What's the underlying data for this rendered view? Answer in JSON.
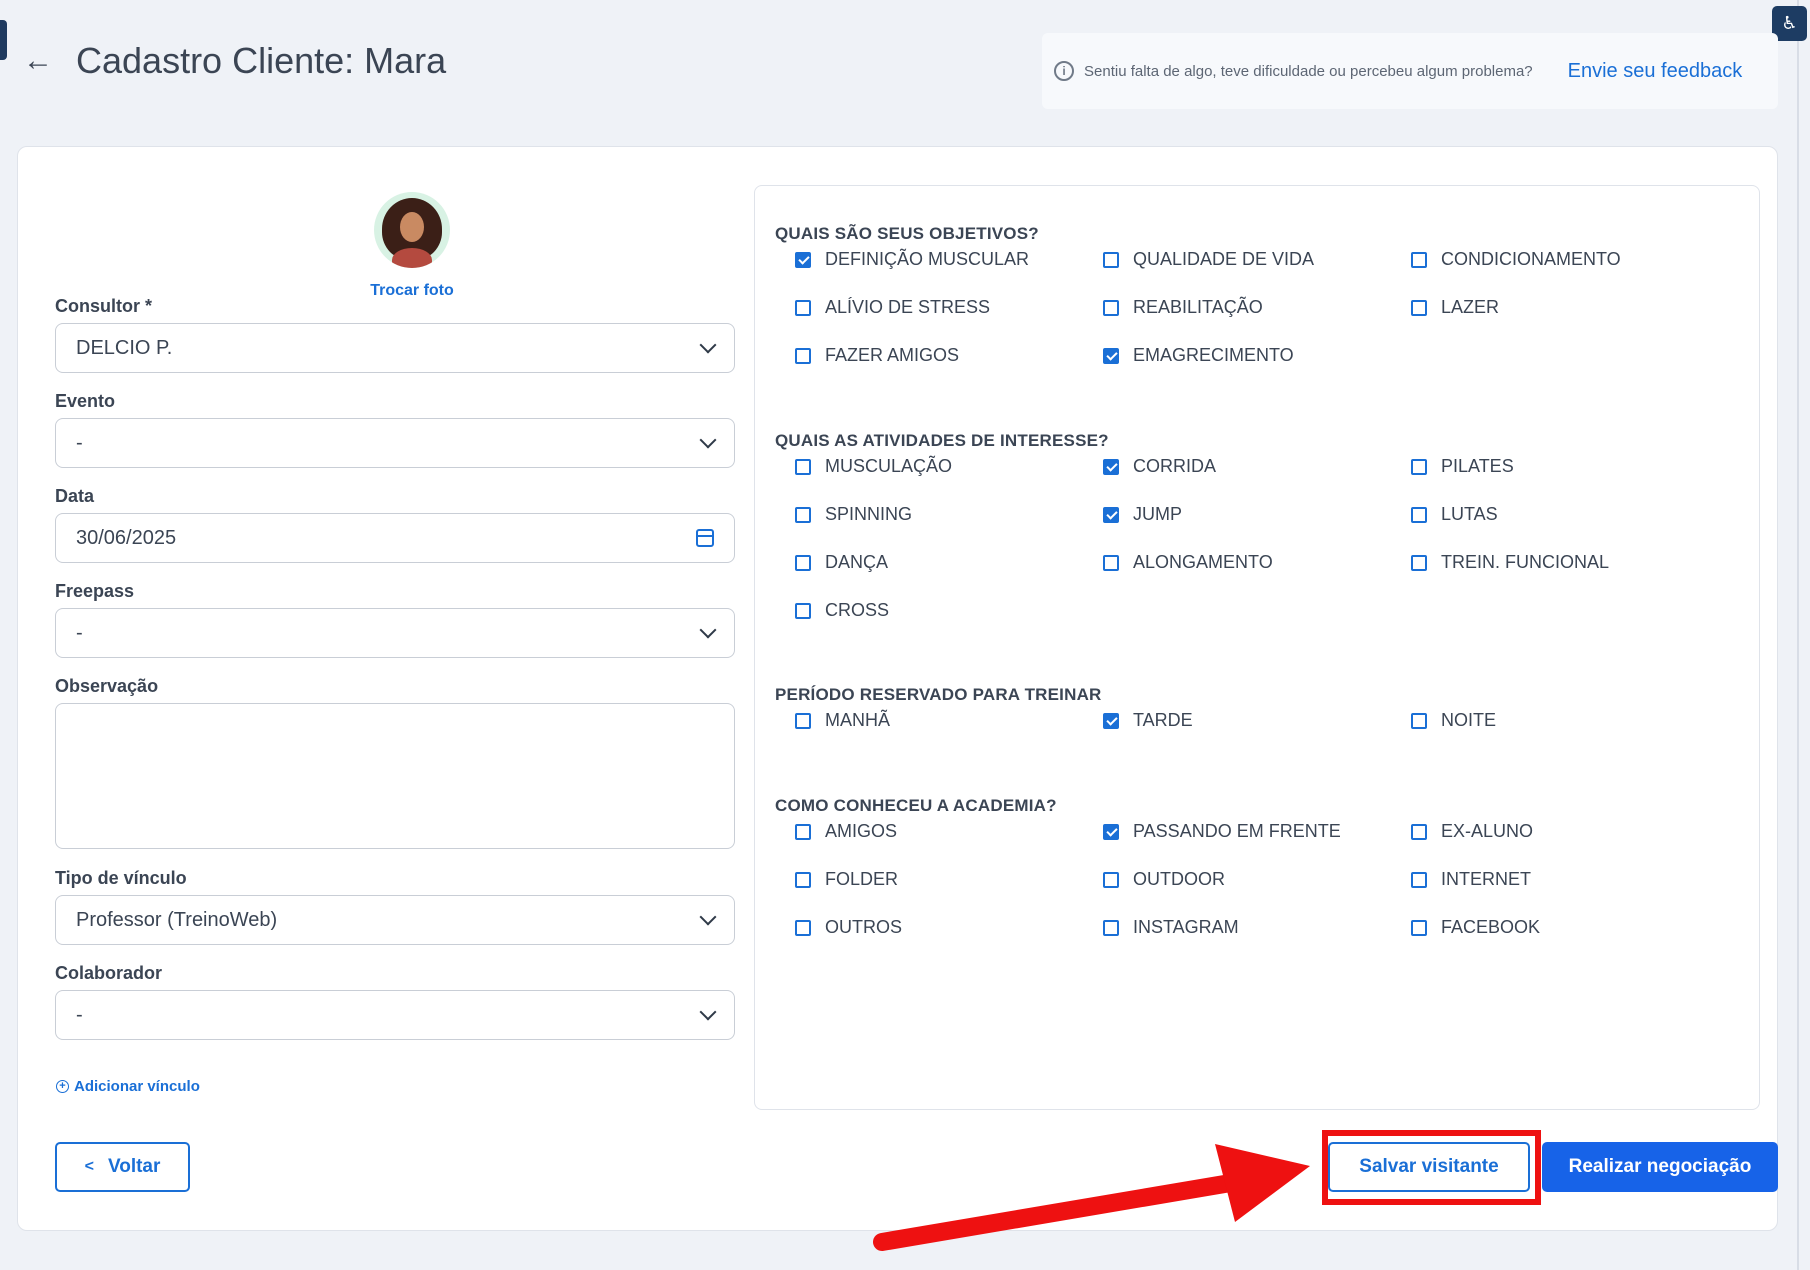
{
  "header": {
    "title": "Cadastro Cliente: Mara",
    "feedback_text": "Sentiu falta de algo, teve dificuldade ou percebeu algum problema?",
    "feedback_link": "Envie seu feedback"
  },
  "profile": {
    "change_photo": "Trocar foto"
  },
  "form": {
    "consultor": {
      "label": "Consultor *",
      "value": "DELCIO P."
    },
    "evento": {
      "label": "Evento",
      "value": "-"
    },
    "data": {
      "label": "Data",
      "value": "30/06/2025"
    },
    "freepass": {
      "label": "Freepass",
      "value": "-"
    },
    "observacao": {
      "label": "Observação",
      "value": ""
    },
    "tipo_vinculo": {
      "label": "Tipo de vínculo",
      "value": "Professor (TreinoWeb)"
    },
    "colaborador": {
      "label": "Colaborador",
      "value": "-"
    },
    "add_vinculo": "Adicionar vínculo"
  },
  "sections": [
    {
      "title": "QUAIS SÃO SEUS OBJETIVOS?",
      "options": [
        {
          "label": "DEFINIÇÃO MUSCULAR",
          "checked": true
        },
        {
          "label": "QUALIDADE DE VIDA",
          "checked": false
        },
        {
          "label": "CONDICIONAMENTO",
          "checked": false
        },
        {
          "label": "ALÍVIO DE STRESS",
          "checked": false
        },
        {
          "label": "REABILITAÇÃO",
          "checked": false
        },
        {
          "label": "LAZER",
          "checked": false
        },
        {
          "label": "FAZER AMIGOS",
          "checked": false
        },
        {
          "label": "EMAGRECIMENTO",
          "checked": true
        }
      ]
    },
    {
      "title": "QUAIS AS ATIVIDADES DE INTERESSE?",
      "options": [
        {
          "label": "MUSCULAÇÃO",
          "checked": false
        },
        {
          "label": "CORRIDA",
          "checked": true
        },
        {
          "label": "PILATES",
          "checked": false
        },
        {
          "label": "SPINNING",
          "checked": false
        },
        {
          "label": "JUMP",
          "checked": true
        },
        {
          "label": "LUTAS",
          "checked": false
        },
        {
          "label": "DANÇA",
          "checked": false
        },
        {
          "label": "ALONGAMENTO",
          "checked": false
        },
        {
          "label": "TREIN. FUNCIONAL",
          "checked": false
        },
        {
          "label": "CROSS",
          "checked": false
        }
      ]
    },
    {
      "title": "PERÍODO RESERVADO PARA TREINAR",
      "options": [
        {
          "label": "MANHÃ",
          "checked": false
        },
        {
          "label": "TARDE",
          "checked": true
        },
        {
          "label": "NOITE",
          "checked": false
        }
      ]
    },
    {
      "title": "COMO CONHECEU A ACADEMIA?",
      "options": [
        {
          "label": "AMIGOS",
          "checked": false
        },
        {
          "label": "PASSANDO EM FRENTE",
          "checked": true
        },
        {
          "label": "EX-ALUNO",
          "checked": false
        },
        {
          "label": "FOLDER",
          "checked": false
        },
        {
          "label": "OUTDOOR",
          "checked": false
        },
        {
          "label": "INTERNET",
          "checked": false
        },
        {
          "label": "OUTROS",
          "checked": false
        },
        {
          "label": "INSTAGRAM",
          "checked": false
        },
        {
          "label": "FACEBOOK",
          "checked": false
        }
      ]
    }
  ],
  "actions": {
    "back": "Voltar",
    "save_visitor": "Salvar visitante",
    "negotiate": "Realizar negociação"
  },
  "colors": {
    "primary": "#1a6fd6",
    "primary_button": "#1763e8",
    "annotation": "#ee1111",
    "background": "#eff2f7"
  }
}
